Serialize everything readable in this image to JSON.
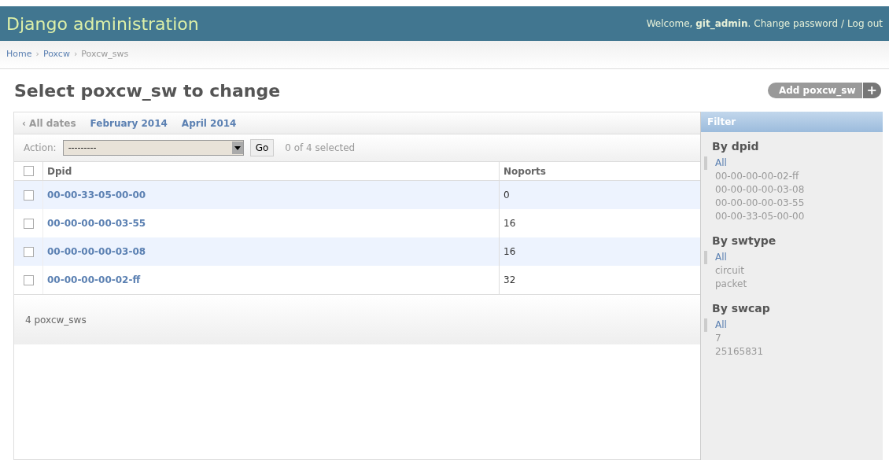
{
  "header": {
    "title": "Django administration",
    "welcome": "Welcome, **git_admin**.",
    "links": [
      "Change password",
      "Log out"
    ],
    "separator": "/"
  },
  "breadcrumbs": [
    "Home",
    "Poxcw",
    "Poxcw_sws"
  ],
  "breadcrumb_separator": "›",
  "page_title": "Select poxcw_sw to change",
  "add_button": {
    "label": "Add poxcw_sw",
    "icon": "+"
  },
  "date_hierarchy": {
    "back": "‹ All dates",
    "links": [
      "February 2014",
      "April 2014"
    ]
  },
  "actions": {
    "label": "Action:",
    "value": "---------",
    "go": "Go",
    "counter": "0 of 4 selected"
  },
  "table": {
    "columns": [
      "Dpid",
      "Noports"
    ],
    "select_all_checked": false,
    "rows": [
      {
        "dpid": "00-00-33-05-00-00",
        "noports": "0",
        "checked": false
      },
      {
        "dpid": "00-00-00-00-03-55",
        "noports": "16",
        "checked": false
      },
      {
        "dpid": "00-00-00-00-03-08",
        "noports": "16",
        "checked": false
      },
      {
        "dpid": "00-00-00-00-02-ff",
        "noports": "32",
        "checked": false
      }
    ]
  },
  "result_count": "4 poxcw_sws",
  "filter": {
    "title": "Filter",
    "groups": [
      {
        "title": "By dpid",
        "choices": [
          {
            "label": "All",
            "selected": true
          },
          {
            "label": "00-00-00-00-02-ff",
            "selected": false
          },
          {
            "label": "00-00-00-00-03-08",
            "selected": false
          },
          {
            "label": "00-00-00-00-03-55",
            "selected": false
          },
          {
            "label": "00-00-33-05-00-00",
            "selected": false
          }
        ]
      },
      {
        "title": "By swtype",
        "choices": [
          {
            "label": "All",
            "selected": true
          },
          {
            "label": "circuit",
            "selected": false
          },
          {
            "label": "packet",
            "selected": false
          }
        ]
      },
      {
        "title": "By swcap",
        "choices": [
          {
            "label": "All",
            "selected": true
          },
          {
            "label": "7",
            "selected": false
          },
          {
            "label": "25165831",
            "selected": false
          }
        ]
      }
    ]
  }
}
